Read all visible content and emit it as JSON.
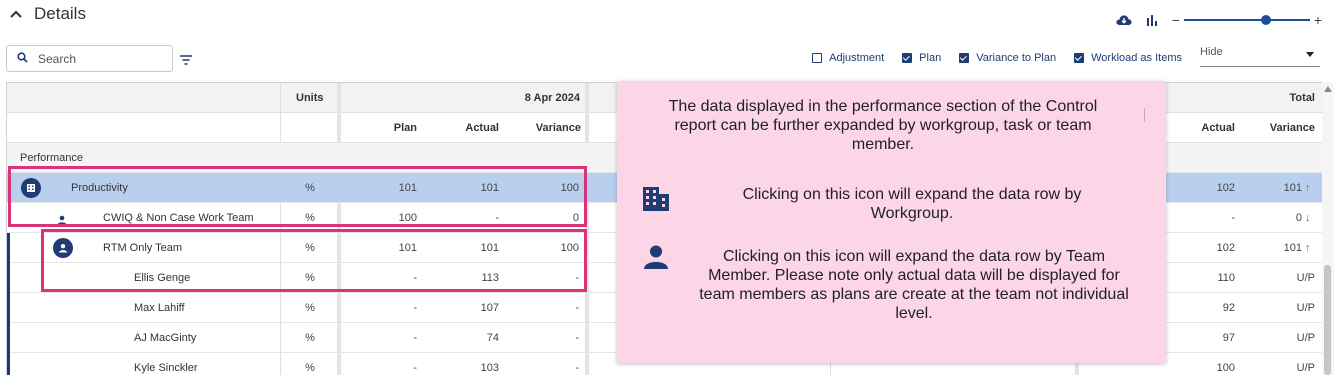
{
  "header": {
    "title": "Details"
  },
  "zoom": {
    "minus": "−",
    "plus": "+",
    "level": 0.65
  },
  "search": {
    "placeholder": "Search"
  },
  "options": [
    {
      "label": "Adjustment",
      "checked": false
    },
    {
      "label": "Plan",
      "checked": true
    },
    {
      "label": "Variance to Plan",
      "checked": true
    },
    {
      "label": "Workload as Items",
      "checked": true
    }
  ],
  "hide_select": {
    "value": "Hide"
  },
  "grid": {
    "units_header": "Units",
    "date_header": "8 Apr 2024",
    "total_header": "Total",
    "sub_headers": {
      "plan": "Plan",
      "actual": "Actual",
      "variance": "Variance",
      "total_actual": "Actual",
      "total_variance": "Variance"
    },
    "section": "Performance",
    "rows": [
      {
        "name": "Productivity",
        "units": "%",
        "plan": "101",
        "actual": "101",
        "variance": "100",
        "total_actual": "102",
        "total_variance": "101",
        "arrow": "↑"
      },
      {
        "name": "CWIQ & Non Case Work Team",
        "units": "%",
        "plan": "100",
        "actual": "-",
        "variance": "0",
        "total_actual": "-",
        "total_variance": "0",
        "arrow": "↓"
      },
      {
        "name": "RTM Only Team",
        "units": "%",
        "plan": "101",
        "actual": "101",
        "variance": "100",
        "total_actual": "102",
        "total_variance": "101",
        "arrow": "↑"
      },
      {
        "name": "Ellis Genge",
        "units": "%",
        "plan": "-",
        "actual": "113",
        "variance": "-",
        "total_actual": "110",
        "total_variance": "U/P",
        "arrow": ""
      },
      {
        "name": "Max Lahiff",
        "units": "%",
        "plan": "-",
        "actual": "107",
        "variance": "-",
        "total_actual": "92",
        "total_variance": "U/P",
        "arrow": ""
      },
      {
        "name": "AJ MacGinty",
        "units": "%",
        "plan": "-",
        "actual": "74",
        "variance": "-",
        "total_actual": "97",
        "total_variance": "U/P",
        "arrow": ""
      },
      {
        "name": "Kyle Sinckler",
        "units": "%",
        "plan": "-",
        "actual": "103",
        "variance": "-",
        "total_actual": "100",
        "total_variance": "U/P",
        "arrow": ""
      }
    ]
  },
  "tooltip": {
    "intro": "The data displayed in the performance section of the Control report can be further expanded by workgroup, task or team member.",
    "workgroup": "Clicking on this icon will expand the data row by Workgroup.",
    "member": "Clicking on this icon will expand the data row by Team Member.  Please note only actual data will be displayed for team members as plans are create at the team not individual level."
  },
  "colors": {
    "accent": "#1f3c73",
    "selected_row": "#b9cfee",
    "highlight": "#d9337a",
    "tooltip_bg": "#fcd6e7",
    "up": "#2e9e4a",
    "down": "#d23b2e"
  }
}
